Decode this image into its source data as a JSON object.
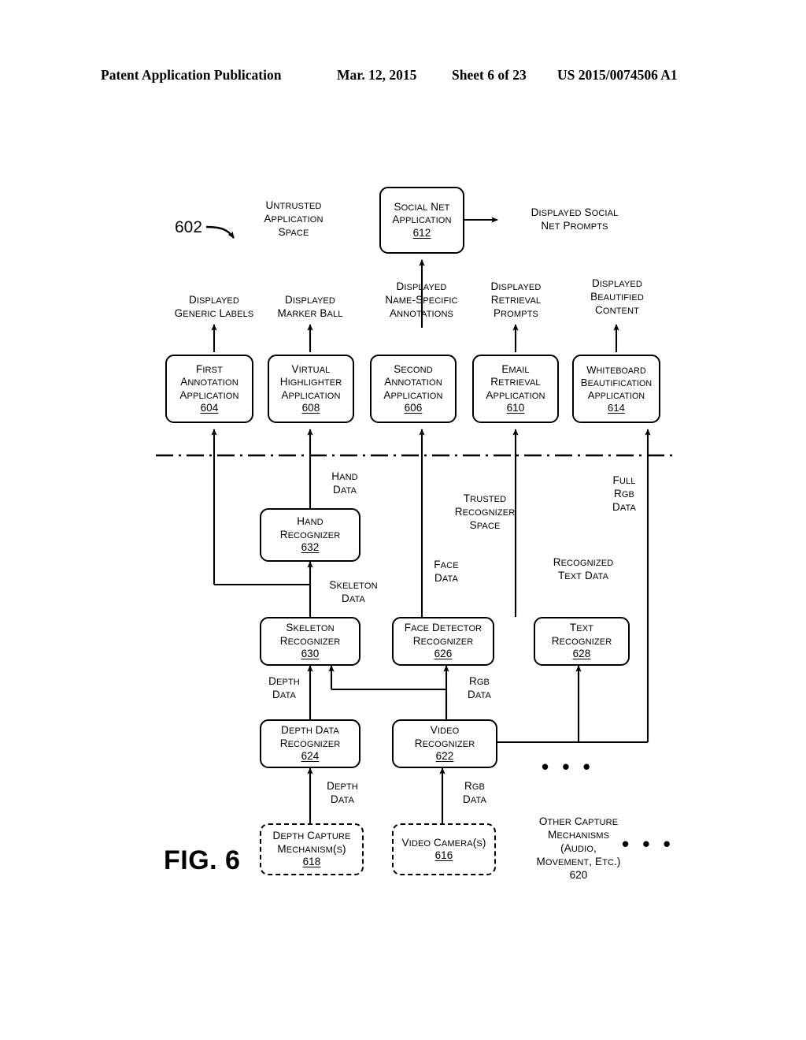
{
  "header": {
    "publication": "Patent Application Publication",
    "date": "Mar. 12, 2015",
    "sheet": "Sheet 6 of 23",
    "number": "US 2015/0074506 A1"
  },
  "figure": {
    "label": "FIG. 6",
    "callout": "602",
    "untrusted_space_label": "Untrusted\nApplication\nSpace",
    "trusted_space_label": "Trusted\nRecognizer\nSpace"
  },
  "space_labels": {
    "untrusted": [
      "Untrusted",
      "Application",
      "Space"
    ],
    "trusted": [
      "Trusted",
      "Recognizer",
      "Space"
    ]
  },
  "nodes": {
    "social_net_application": {
      "lines": [
        "Social Net",
        "Application"
      ],
      "ref": "612",
      "underlined": true,
      "dashed": false
    },
    "first_annotation_application": {
      "lines": [
        "First",
        "Annotation",
        "Application"
      ],
      "ref": "604",
      "underlined": true,
      "dashed": false
    },
    "virtual_highlighter_application": {
      "lines": [
        "Virtual",
        "Highlighter",
        "Application"
      ],
      "ref": "608",
      "underlined": true,
      "dashed": false
    },
    "second_annotation_application": {
      "lines": [
        "Second",
        "Annotation",
        "Application"
      ],
      "ref": "606",
      "underlined": true,
      "dashed": false
    },
    "email_retrieval_application": {
      "lines": [
        "Email",
        "Retrieval",
        "Application"
      ],
      "ref": "610",
      "underlined": true,
      "dashed": false
    },
    "whiteboard_beautification_application": {
      "lines": [
        "Whiteboard",
        "Beautification",
        "Application"
      ],
      "ref": "614",
      "underlined": true,
      "dashed": false
    },
    "hand_recognizer": {
      "lines": [
        "Hand",
        "Recognizer"
      ],
      "ref": "632",
      "underlined": true,
      "dashed": false
    },
    "skeleton_recognizer": {
      "lines": [
        "Skeleton",
        "Recognizer"
      ],
      "ref": "630",
      "underlined": true,
      "dashed": false
    },
    "face_detector_recognizer": {
      "lines": [
        "Face Detector",
        "Recognizer"
      ],
      "ref": "626",
      "underlined": true,
      "dashed": false
    },
    "text_recognizer": {
      "lines": [
        "Text",
        "Recognizer"
      ],
      "ref": "628",
      "underlined": true,
      "dashed": false
    },
    "depth_data_recognizer": {
      "lines": [
        "Depth Data",
        "Recognizer"
      ],
      "ref": "624",
      "underlined": true,
      "dashed": false
    },
    "video_recognizer": {
      "lines": [
        "Video",
        "Recognizer"
      ],
      "ref": "622",
      "underlined": true,
      "dashed": false
    },
    "depth_capture_mechanisms": {
      "lines": [
        "Depth Capture",
        "Mechanism(s)"
      ],
      "ref": "618",
      "underlined": true,
      "dashed": true
    },
    "video_cameras": {
      "lines": [
        "Video Camera(s)"
      ],
      "ref": "616",
      "underlined": true,
      "dashed": true
    },
    "other_capture_mechanisms": {
      "lines": [
        "Other Capture",
        "Mechanisms",
        "(Audio,",
        "Movement, etc.)"
      ],
      "ref": "620",
      "underlined": false,
      "dashed": false
    }
  },
  "edge_labels": {
    "displayed_social_net_prompts": [
      "Displayed Social",
      "Net Prompts"
    ],
    "displayed_generic_labels": [
      "Displayed",
      "Generic Labels"
    ],
    "displayed_marker_ball": [
      "Displayed",
      "Marker Ball"
    ],
    "displayed_name_specific_annotations": [
      "Displayed",
      "Name-Specific",
      "Annotations"
    ],
    "displayed_retrieval_prompts": [
      "Displayed",
      "Retrieval",
      "Prompts"
    ],
    "displayed_beautified_content": [
      "Displayed",
      "Beautified",
      "Content"
    ],
    "hand_data": [
      "Hand",
      "Data"
    ],
    "full_rgb_data": [
      "Full",
      "RGB",
      "Data"
    ],
    "skeleton_data": [
      "Skeleton",
      "Data"
    ],
    "face_data": [
      "Face",
      "Data"
    ],
    "recognized_text_data": [
      "Recognized",
      "Text Data"
    ],
    "depth_data_upper": [
      "Depth",
      "Data"
    ],
    "rgb_data_upper": [
      "RGB",
      "Data"
    ],
    "depth_data_lower": [
      "Depth",
      "Data"
    ],
    "rgb_data_lower": [
      "RGB",
      "Data"
    ]
  },
  "ellipses": {
    "middle_right": "• • •",
    "bottom_right": "• • •"
  },
  "colors": {
    "ink": "#000000",
    "background": "#ffffff"
  }
}
